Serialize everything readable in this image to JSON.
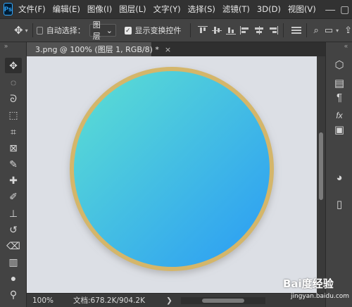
{
  "app": {
    "logo_text": "Ps"
  },
  "menu": {
    "items": [
      "文件(F)",
      "编辑(E)",
      "图像(I)",
      "图层(L)",
      "文字(Y)",
      "选择(S)",
      "滤镜(T)",
      "3D(D)",
      "视图(V)"
    ],
    "window_minimize": "—",
    "window_restore": "▢"
  },
  "options_bar": {
    "auto_select_label": "自动选择：",
    "auto_select_checked": false,
    "layer_select_value": "图层",
    "show_transform_label": "显示变换控件",
    "show_transform_checked": true
  },
  "document": {
    "tab_title": "3.png @ 100% (图层 1, RGB/8) *",
    "close_glyph": "×"
  },
  "canvas": {
    "background_color": "#dcdfe5",
    "frame_color": "#d4b66a",
    "gradient_start": "#5de0d2",
    "gradient_end": "#2a9bf5"
  },
  "status": {
    "zoom": "100%",
    "doc_info": "文档:678.2K/904.2K",
    "arrow": "❯"
  },
  "watermark": {
    "brand": "Bai度经验",
    "url": "jingyan.baidu.com"
  },
  "tools_left": [
    "move-icon",
    "lasso-ellipse-icon",
    "lasso-icon",
    "quick-select-icon",
    "crop-icon",
    "frame-icon",
    "eyedropper-icon",
    "healing-icon",
    "brush-icon",
    "stamp-icon",
    "history-brush-icon",
    "eraser-icon",
    "gradient-icon",
    "blur-icon",
    "dodge-icon",
    "pen-icon"
  ],
  "tools_right": [
    "3d-cube-icon",
    "properties-icon",
    "paragraph-icon",
    "fx-icon",
    "libraries-icon",
    "palette-icon",
    "adjust-icon"
  ]
}
